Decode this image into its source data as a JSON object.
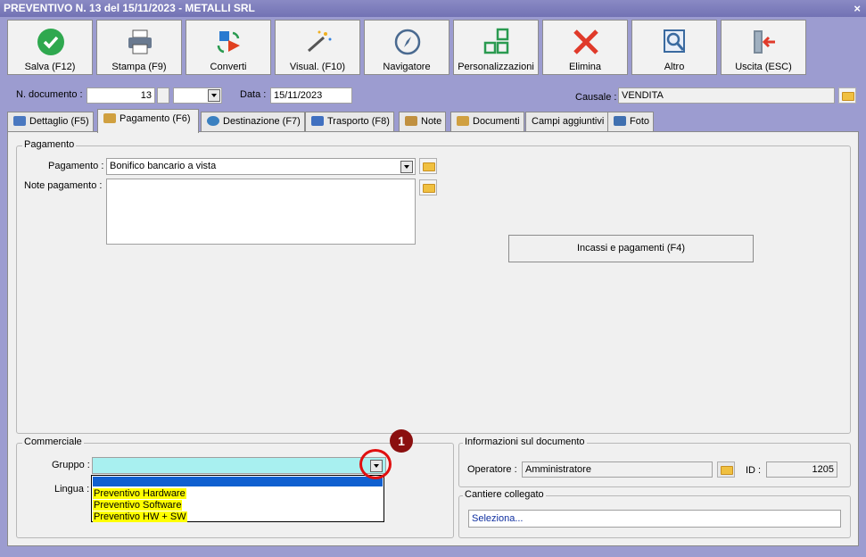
{
  "window": {
    "title": "PREVENTIVO N. 13 del 15/11/2023 - METALLI SRL",
    "close": "×"
  },
  "toolbar": [
    {
      "label": "Salva (F12)",
      "icon": "save-check-icon"
    },
    {
      "label": "Stampa (F9)",
      "icon": "printer-icon"
    },
    {
      "label": "Converti",
      "icon": "convert-icon"
    },
    {
      "label": "Visual. (F10)",
      "icon": "magic-wand-icon"
    },
    {
      "label": "Navigatore",
      "icon": "compass-icon"
    },
    {
      "label": "Personalizzazioni",
      "icon": "grid-icon"
    },
    {
      "label": "Elimina",
      "icon": "delete-x-icon"
    },
    {
      "label": "Altro",
      "icon": "magnifier-icon"
    },
    {
      "label": "Uscita (ESC)",
      "icon": "exit-door-icon"
    }
  ],
  "header": {
    "n_documento_label": "N. documento :",
    "n_documento_value": "13",
    "data_label": "Data :",
    "data_value": "15/11/2023",
    "causale_label": "Causale :",
    "causale_value": "VENDITA"
  },
  "tabs": [
    {
      "label": "Dettaglio (F5)",
      "color": "#4a78c0"
    },
    {
      "label": "Pagamento (F6)",
      "color": "#d0a040"
    },
    {
      "label": "Destinazione (F7)",
      "color": "#3a80c0"
    },
    {
      "label": "Trasporto (F8)",
      "color": "#4070c0"
    },
    {
      "label": "Note",
      "color": "#c09040"
    },
    {
      "label": "Documenti",
      "color": "#d0a040"
    },
    {
      "label": "Campi aggiuntivi",
      "color": ""
    },
    {
      "label": "Foto",
      "color": "#4070b0"
    }
  ],
  "pagamento": {
    "group_label": "Pagamento",
    "pagamento_label": "Pagamento :",
    "pagamento_value": "Bonifico bancario a vista",
    "note_label": "Note pagamento :",
    "note_value": "",
    "incassi_button": "Incassi e pagamenti (F4)"
  },
  "commerciale": {
    "group_label": "Commerciale",
    "gruppo_label": "Gruppo :",
    "gruppo_value": "",
    "lingua_label": "Lingua :",
    "options": [
      "Preventivo Hardware",
      "Preventivo Software",
      "Preventivo HW + SW"
    ],
    "callout_number": "1"
  },
  "info": {
    "group_label": "Informazioni sul documento",
    "operatore_label": "Operatore :",
    "operatore_value": "Amministratore",
    "id_label": "ID :",
    "id_value": "1205"
  },
  "cantiere": {
    "group_label": "Cantiere collegato",
    "placeholder": "Seleziona..."
  }
}
